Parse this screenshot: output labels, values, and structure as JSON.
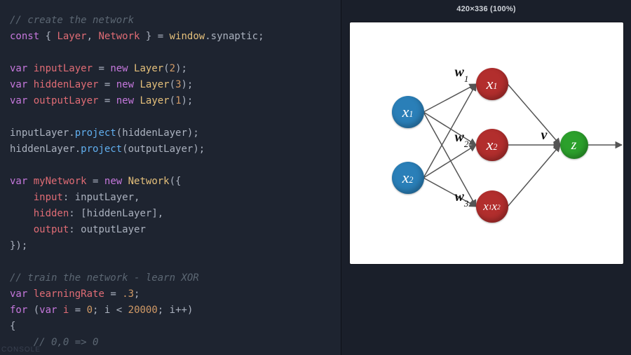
{
  "editor": {
    "comment1": "// create the network",
    "line_const": {
      "kw": "const",
      "brace_open": " { ",
      "v1": "Layer",
      "comma": ", ",
      "v2": "Network",
      "brace_close": " } ",
      "eq": "= ",
      "win": "window",
      "dot": ".",
      "member": "synaptic",
      "semi": ";"
    },
    "decl_input": {
      "kw": "var",
      "name": "inputLayer",
      "eq": " = ",
      "newkw": "new ",
      "type": "Layer",
      "open": "(",
      "n": "2",
      "close": ");"
    },
    "decl_hidden": {
      "kw": "var",
      "name": "hiddenLayer",
      "eq": " = ",
      "newkw": "new ",
      "type": "Layer",
      "open": "(",
      "n": "3",
      "close": ");"
    },
    "decl_output": {
      "kw": "var",
      "name": "outputLayer",
      "eq": " = ",
      "newkw": "new ",
      "type": "Layer",
      "open": "(",
      "n": "1",
      "close": ");"
    },
    "proj1": {
      "obj": "inputLayer",
      "dot": ".",
      "fn": "project",
      "open": "(",
      "arg": "hiddenLayer",
      "close": ");"
    },
    "proj2": {
      "obj": "hiddenLayer",
      "dot": ".",
      "fn": "project",
      "open": "(",
      "arg": "outputLayer",
      "close": ");"
    },
    "network_decl": {
      "kw": "var",
      "name": "myNetwork",
      "eq": " = ",
      "newkw": "new ",
      "type": "Network",
      "open": "({"
    },
    "prop_input": {
      "pad": "    ",
      "key": "input",
      "colon": ": ",
      "val": "inputLayer",
      "trail": ","
    },
    "prop_hidden": {
      "pad": "    ",
      "key": "hidden",
      "colon": ": ",
      "open": "[",
      "val": "hiddenLayer",
      "close": "]",
      "trail": ","
    },
    "prop_output": {
      "pad": "    ",
      "key": "output",
      "colon": ": ",
      "val": "outputLayer"
    },
    "network_close": "});",
    "comment2": "// train the network - learn XOR",
    "decl_lr": {
      "kw": "var",
      "name": "learningRate",
      "eq": " = ",
      "n": ".3",
      "semi": ";"
    },
    "for_line": {
      "kw": "for",
      "open": " (",
      "varkw": "var ",
      "i": "i",
      "eq": " = ",
      "zero": "0",
      "semi1": "; ",
      "i2": "i",
      "lt": " < ",
      "limit": "20000",
      "semi2": "; ",
      "i3": "i",
      "inc": "++",
      "close": ")"
    },
    "brace_open": "{",
    "comment3": "    // 0,0 => 0",
    "console_label": "CONSOLE"
  },
  "preview": {
    "header": "420×336 (100%)",
    "nodes": {
      "x1_in": {
        "label_main": "x",
        "label_sub": "1"
      },
      "x2_in": {
        "label_main": "x",
        "label_sub": "2"
      },
      "h1": {
        "label_main": "x",
        "label_sub": "1"
      },
      "h2": {
        "label_main": "x",
        "label_sub": "2"
      },
      "h3": {
        "label_main": "x",
        "label_sub": "1",
        "label_main2": "x",
        "label_sub2": "2"
      },
      "z": {
        "label_main": "z"
      }
    },
    "weights": {
      "w1": {
        "main": "w",
        "sub": "1"
      },
      "w2": {
        "main": "w",
        "sub": "2"
      },
      "w3": {
        "main": "w",
        "sub": "3"
      },
      "v": {
        "main": "v"
      }
    }
  }
}
